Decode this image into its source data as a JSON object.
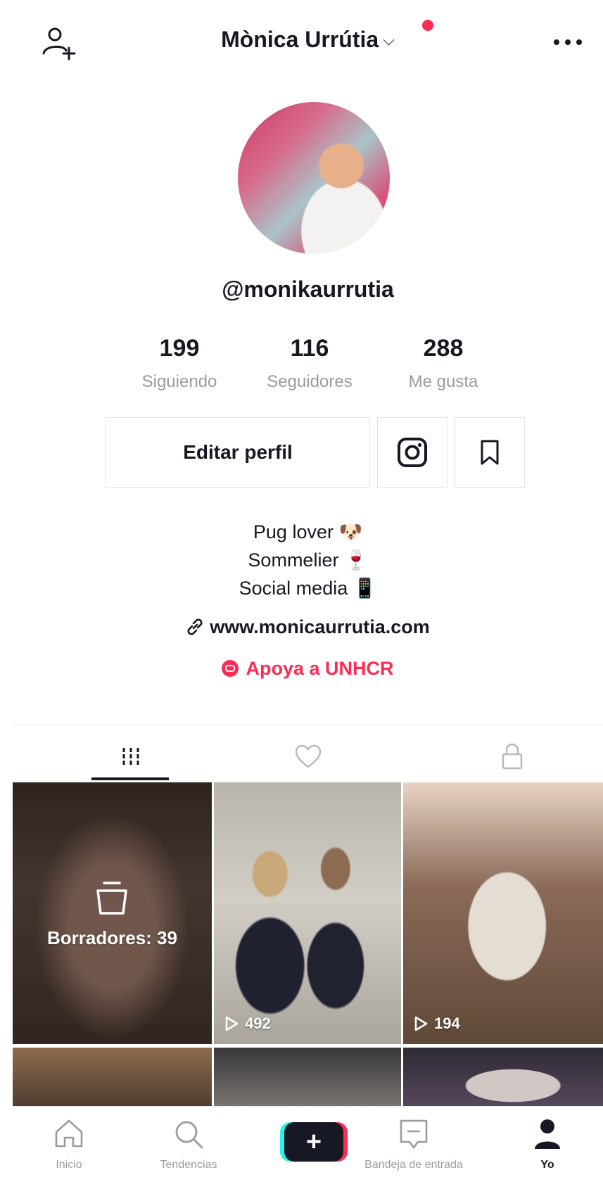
{
  "header": {
    "title": "Mònica Urrútia",
    "chevron": "⌵",
    "add_friend_icon": "add-user-icon",
    "more_icon": "more-icon",
    "notification_dot_color": "#fe2c55"
  },
  "profile": {
    "username": "@monikaurrutia",
    "stats": [
      {
        "value": "199",
        "label": "Siguiendo"
      },
      {
        "value": "116",
        "label": "Seguidores"
      },
      {
        "value": "288",
        "label": "Me gusta"
      }
    ],
    "edit_button": "Editar perfil",
    "bio": [
      "Pug lover 🐶",
      "Sommelier 🍷",
      "Social media 📱"
    ],
    "website": "www.monicaurrutia.com",
    "donate": "Apoya a UNHCR"
  },
  "tabs": [
    {
      "icon": "videos-grid-icon",
      "active": true
    },
    {
      "icon": "heart-icon",
      "active": false
    },
    {
      "icon": "lock-icon",
      "active": false
    }
  ],
  "videos": {
    "drafts_label": "Borradores: 39",
    "items": [
      {
        "plays": "492"
      },
      {
        "plays": "194"
      }
    ]
  },
  "bottom_nav": {
    "items": [
      {
        "label": "Inicio"
      },
      {
        "label": "Tendencias"
      },
      {
        "label": "Bandeja de entrada"
      },
      {
        "label": "Yo"
      }
    ],
    "create_label": "+"
  },
  "colors": {
    "accent": "#fe2c55",
    "cyan": "#25f4ee",
    "text": "#161823",
    "muted": "#9a9ba2"
  }
}
